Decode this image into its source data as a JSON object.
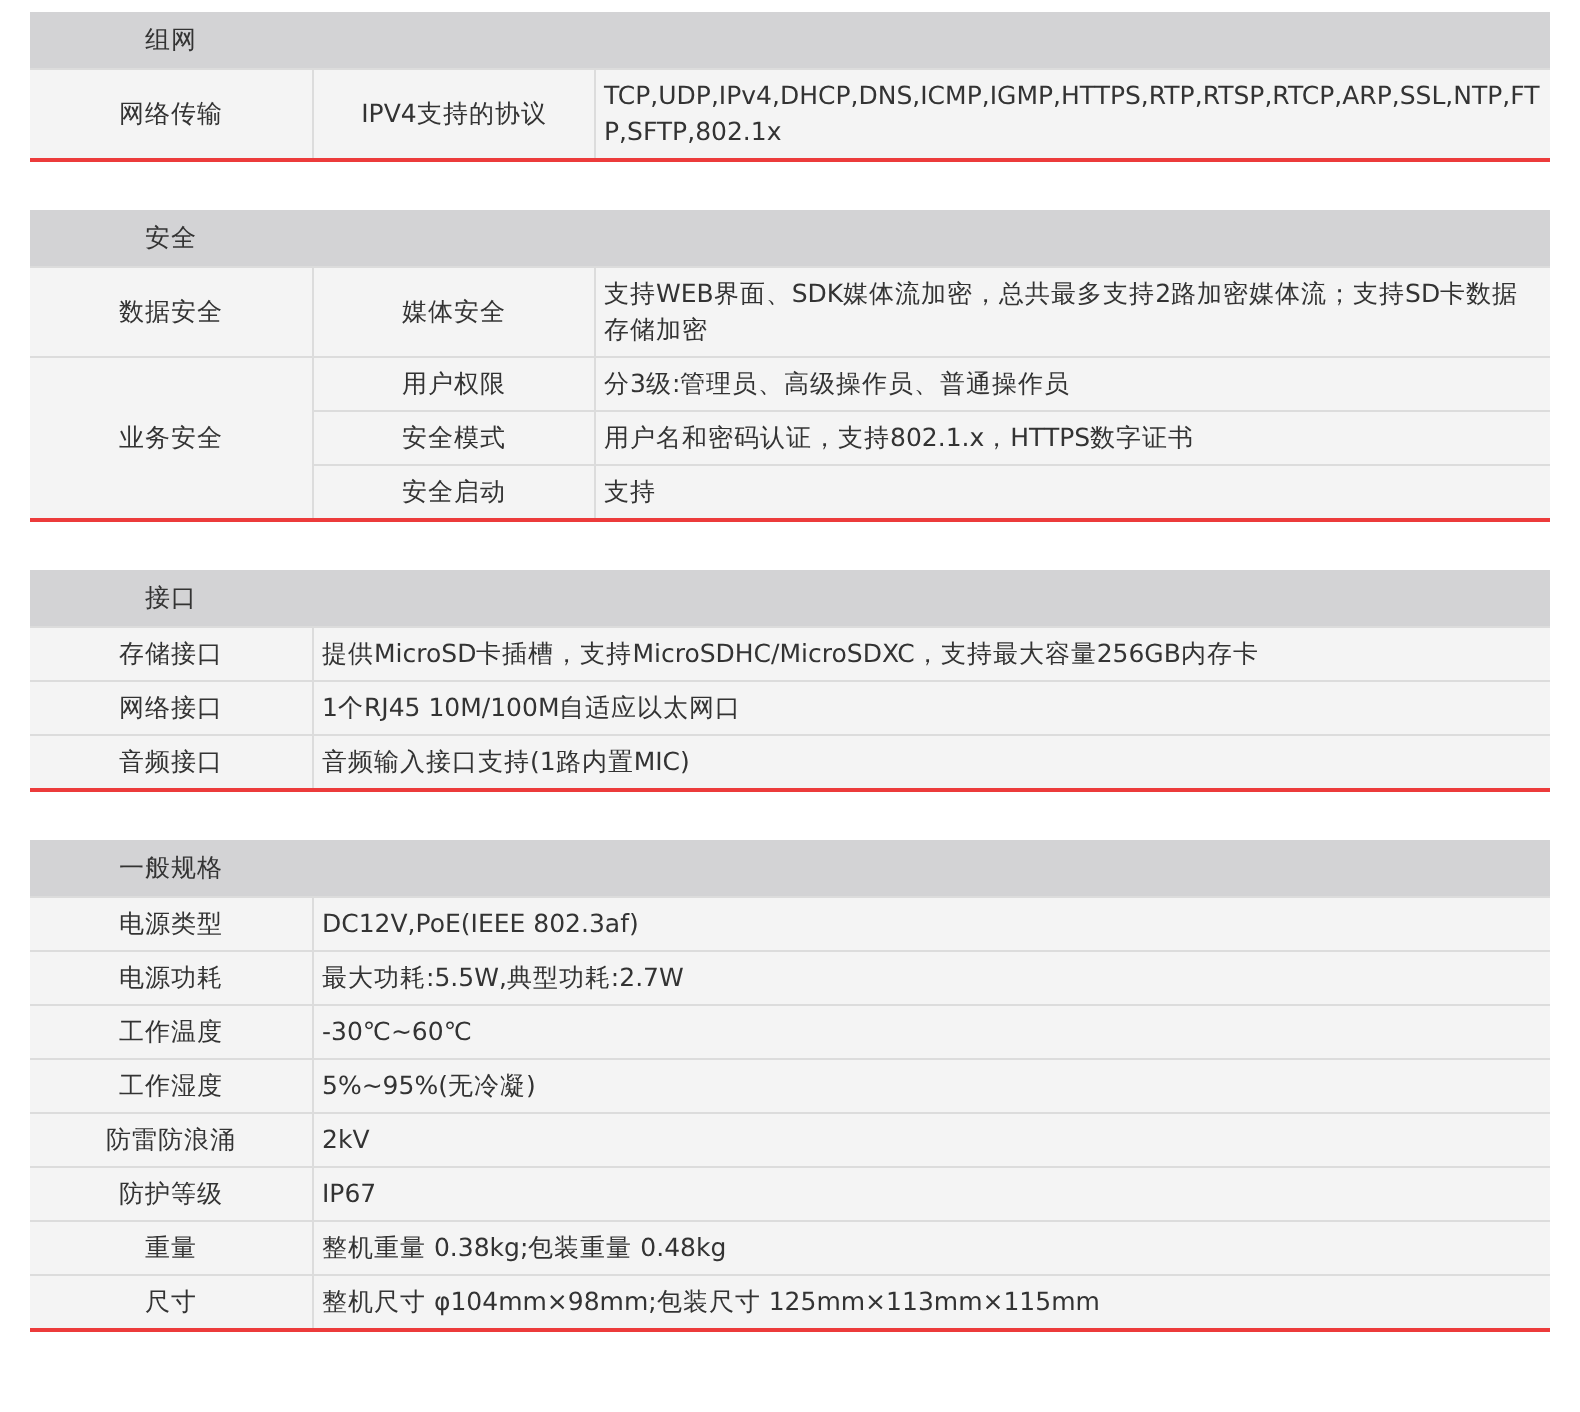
{
  "sections": [
    {
      "title": "组网",
      "kind": "three_column",
      "groups": [
        {
          "category": "网络传输",
          "items": [
            {
              "name": "IPV4支持的协议",
              "value": "TCP,UDP,IPv4,DHCP,DNS,ICMP,IGMP,HTTPS,RTP,RTSP,RTCP,ARP,SSL,NTP,FTP,SFTP,802.1x"
            }
          ]
        }
      ]
    },
    {
      "title": "安全",
      "kind": "three_column",
      "groups": [
        {
          "category": "数据安全",
          "items": [
            {
              "name": "媒体安全",
              "value": "支持WEB界面、SDK媒体流加密，总共最多支持2路加密媒体流；支持SD卡数据存储加密"
            }
          ]
        },
        {
          "category": "业务安全",
          "items": [
            {
              "name": "用户权限",
              "value": "分3级:管理员、高级操作员、普通操作员"
            },
            {
              "name": "安全模式",
              "value": "用户名和密码认证，支持802.1.x，HTTPS数字证书"
            },
            {
              "name": "安全启动",
              "value": "支持"
            }
          ]
        }
      ]
    },
    {
      "title": "接口",
      "kind": "two_column",
      "rows": [
        {
          "name": "存储接口",
          "value": "提供MicroSD卡插槽，支持MicroSDHC/MicroSDXC，支持最大容量256GB内存卡"
        },
        {
          "name": "网络接口",
          "value": "1个RJ45 10M/100M自适应以太网口"
        },
        {
          "name": "音频接口",
          "value": "音频输入接口支持(1路内置MIC)"
        }
      ]
    },
    {
      "title": "一般规格",
      "kind": "two_column",
      "rows": [
        {
          "name": "电源类型",
          "value": "DC12V,PoE(IEEE 802.3af)"
        },
        {
          "name": "电源功耗",
          "value": "最大功耗:5.5W,典型功耗:2.7W"
        },
        {
          "name": "工作温度",
          "value": "-30℃~60℃"
        },
        {
          "name": "工作湿度",
          "value": "5%~95%(无冷凝)"
        },
        {
          "name": "防雷防浪涌",
          "value": "2kV"
        },
        {
          "name": "防护等级",
          "value": "IP67"
        },
        {
          "name": "重量",
          "value": "整机重量 0.38kg;包装重量 0.48kg"
        },
        {
          "name": "尺寸",
          "value": "整机尺寸 φ104mm×98mm;包装尺寸 125mm×113mm×115mm"
        }
      ]
    }
  ]
}
